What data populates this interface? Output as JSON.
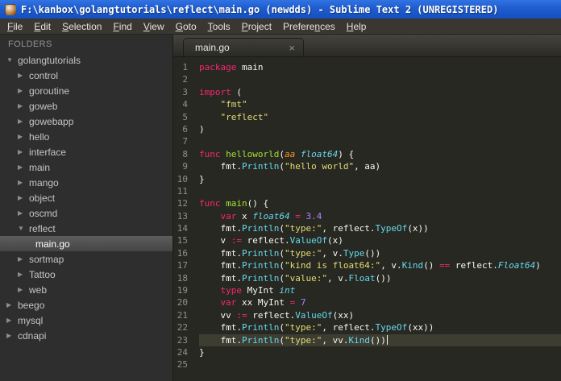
{
  "theme": {
    "bg-editor": "#272822",
    "line-hl": "#3E3D32",
    "kw": "#F92672",
    "fn": "#A6E22E",
    "ty": "#66D9EF",
    "st": "#E6DB74",
    "nu": "#AE81FF",
    "pa": "#FD971F",
    "pl": "#F8F8F2",
    "ln": "#8F908A"
  },
  "window": {
    "title": "F:\\kanbox\\golangtutorials\\reflect\\main.go (newdds) - Sublime Text 2 (UNREGISTERED)"
  },
  "menu": {
    "items": [
      {
        "label": "File",
        "mnemonic": 0
      },
      {
        "label": "Edit",
        "mnemonic": 0
      },
      {
        "label": "Selection",
        "mnemonic": 0
      },
      {
        "label": "Find",
        "mnemonic": 0
      },
      {
        "label": "View",
        "mnemonic": 0
      },
      {
        "label": "Goto",
        "mnemonic": 0
      },
      {
        "label": "Tools",
        "mnemonic": 0
      },
      {
        "label": "Project",
        "mnemonic": 0
      },
      {
        "label": "Preferences",
        "mnemonic": 7
      },
      {
        "label": "Help",
        "mnemonic": 0
      }
    ]
  },
  "sidebar": {
    "header": "FOLDERS",
    "tree": [
      {
        "label": "golangtutorials",
        "level": 0,
        "type": "folder",
        "expanded": true
      },
      {
        "label": "control",
        "level": 1,
        "type": "folder",
        "expanded": false
      },
      {
        "label": "goroutine",
        "level": 1,
        "type": "folder",
        "expanded": false
      },
      {
        "label": "goweb",
        "level": 1,
        "type": "folder",
        "expanded": false
      },
      {
        "label": "gowebapp",
        "level": 1,
        "type": "folder",
        "expanded": false
      },
      {
        "label": "hello",
        "level": 1,
        "type": "folder",
        "expanded": false
      },
      {
        "label": "interface",
        "level": 1,
        "type": "folder",
        "expanded": false
      },
      {
        "label": "main",
        "level": 1,
        "type": "folder",
        "expanded": false
      },
      {
        "label": "mango",
        "level": 1,
        "type": "folder",
        "expanded": false
      },
      {
        "label": "object",
        "level": 1,
        "type": "folder",
        "expanded": false
      },
      {
        "label": "oscmd",
        "level": 1,
        "type": "folder",
        "expanded": false
      },
      {
        "label": "reflect",
        "level": 1,
        "type": "folder",
        "expanded": true
      },
      {
        "label": "main.go",
        "level": 2,
        "type": "file",
        "selected": true
      },
      {
        "label": "sortmap",
        "level": 1,
        "type": "folder",
        "expanded": false
      },
      {
        "label": "Tattoo",
        "level": 1,
        "type": "folder",
        "expanded": false
      },
      {
        "label": "web",
        "level": 1,
        "type": "folder",
        "expanded": false
      },
      {
        "label": "beego",
        "level": 0,
        "type": "folder",
        "expanded": false
      },
      {
        "label": "mysql",
        "level": 0,
        "type": "folder",
        "expanded": false
      },
      {
        "label": "cdnapi",
        "level": 0,
        "type": "folder",
        "expanded": false
      }
    ]
  },
  "tabs": [
    {
      "label": "main.go",
      "close_glyph": "×",
      "active": true
    }
  ],
  "editor": {
    "lines": [
      {
        "num": 1,
        "tokens": [
          [
            "kw",
            "package"
          ],
          [
            "pl",
            " main"
          ]
        ]
      },
      {
        "num": 2,
        "tokens": []
      },
      {
        "num": 3,
        "tokens": [
          [
            "kw",
            "import"
          ],
          [
            "pl",
            " ("
          ]
        ]
      },
      {
        "num": 4,
        "tokens": [
          [
            "pl",
            "    "
          ],
          [
            "st",
            "\"fmt\""
          ]
        ]
      },
      {
        "num": 5,
        "tokens": [
          [
            "pl",
            "    "
          ],
          [
            "st",
            "\"reflect\""
          ]
        ]
      },
      {
        "num": 6,
        "tokens": [
          [
            "pl",
            ")"
          ]
        ]
      },
      {
        "num": 7,
        "tokens": []
      },
      {
        "num": 8,
        "tokens": [
          [
            "kw",
            "func"
          ],
          [
            "fn",
            " helloworld"
          ],
          [
            "pl",
            "("
          ],
          [
            "pa",
            "aa"
          ],
          [
            "pl",
            " "
          ],
          [
            "ty",
            "float64"
          ],
          [
            "pl",
            ") {"
          ]
        ]
      },
      {
        "num": 9,
        "tokens": [
          [
            "pl",
            "    fmt."
          ],
          [
            "su",
            "Println"
          ],
          [
            "pl",
            "("
          ],
          [
            "st",
            "\"hello world\""
          ],
          [
            "pl",
            ", aa)"
          ]
        ]
      },
      {
        "num": 10,
        "tokens": [
          [
            "pl",
            "}"
          ]
        ]
      },
      {
        "num": 11,
        "tokens": []
      },
      {
        "num": 12,
        "tokens": [
          [
            "kw",
            "func"
          ],
          [
            "fn",
            " main"
          ],
          [
            "pl",
            "() {"
          ]
        ]
      },
      {
        "num": 13,
        "tokens": [
          [
            "pl",
            "    "
          ],
          [
            "kw",
            "var"
          ],
          [
            "pl",
            " x "
          ],
          [
            "ty",
            "float64"
          ],
          [
            "pl",
            " "
          ],
          [
            "kw",
            "="
          ],
          [
            "pl",
            " "
          ],
          [
            "nu",
            "3.4"
          ]
        ]
      },
      {
        "num": 14,
        "tokens": [
          [
            "pl",
            "    fmt."
          ],
          [
            "su",
            "Println"
          ],
          [
            "pl",
            "("
          ],
          [
            "st",
            "\"type:\""
          ],
          [
            "pl",
            ", reflect."
          ],
          [
            "su",
            "TypeOf"
          ],
          [
            "pl",
            "(x))"
          ]
        ]
      },
      {
        "num": 15,
        "tokens": [
          [
            "pl",
            "    v "
          ],
          [
            "kw",
            ":="
          ],
          [
            "pl",
            " reflect."
          ],
          [
            "su",
            "ValueOf"
          ],
          [
            "pl",
            "(x)"
          ]
        ]
      },
      {
        "num": 16,
        "tokens": [
          [
            "pl",
            "    fmt."
          ],
          [
            "su",
            "Println"
          ],
          [
            "pl",
            "("
          ],
          [
            "st",
            "\"type:\""
          ],
          [
            "pl",
            ", v."
          ],
          [
            "su",
            "Type"
          ],
          [
            "pl",
            "())"
          ]
        ]
      },
      {
        "num": 17,
        "tokens": [
          [
            "pl",
            "    fmt."
          ],
          [
            "su",
            "Println"
          ],
          [
            "pl",
            "("
          ],
          [
            "st",
            "\"kind is float64:\""
          ],
          [
            "pl",
            ", v."
          ],
          [
            "su",
            "Kind"
          ],
          [
            "pl",
            "() "
          ],
          [
            "kw",
            "=="
          ],
          [
            "pl",
            " reflect."
          ],
          [
            "ty",
            "Float64"
          ],
          [
            "pl",
            ")"
          ]
        ]
      },
      {
        "num": 18,
        "tokens": [
          [
            "pl",
            "    fmt."
          ],
          [
            "su",
            "Println"
          ],
          [
            "pl",
            "("
          ],
          [
            "st",
            "\"value:\""
          ],
          [
            "pl",
            ", v."
          ],
          [
            "su",
            "Float"
          ],
          [
            "pl",
            "())"
          ]
        ]
      },
      {
        "num": 19,
        "tokens": [
          [
            "pl",
            "    "
          ],
          [
            "kw",
            "type"
          ],
          [
            "pl",
            " MyInt "
          ],
          [
            "ty",
            "int"
          ]
        ]
      },
      {
        "num": 20,
        "tokens": [
          [
            "pl",
            "    "
          ],
          [
            "kw",
            "var"
          ],
          [
            "pl",
            " xx MyInt "
          ],
          [
            "kw",
            "="
          ],
          [
            "pl",
            " "
          ],
          [
            "nu",
            "7"
          ]
        ]
      },
      {
        "num": 21,
        "tokens": [
          [
            "pl",
            "    vv "
          ],
          [
            "kw",
            ":="
          ],
          [
            "pl",
            " reflect."
          ],
          [
            "su",
            "ValueOf"
          ],
          [
            "pl",
            "(xx)"
          ]
        ]
      },
      {
        "num": 22,
        "tokens": [
          [
            "pl",
            "    fmt."
          ],
          [
            "su",
            "Println"
          ],
          [
            "pl",
            "("
          ],
          [
            "st",
            "\"type:\""
          ],
          [
            "pl",
            ", reflect."
          ],
          [
            "su",
            "TypeOf"
          ],
          [
            "pl",
            "(xx))"
          ]
        ]
      },
      {
        "num": 23,
        "tokens": [
          [
            "pl",
            "    fmt."
          ],
          [
            "su",
            "Println"
          ],
          [
            "pl",
            "("
          ],
          [
            "st",
            "\"type:\""
          ],
          [
            "pl",
            ", vv."
          ],
          [
            "su",
            "Kind"
          ],
          [
            "pl",
            "())"
          ]
        ],
        "current": true
      },
      {
        "num": 24,
        "tokens": [
          [
            "pl",
            "}"
          ]
        ]
      },
      {
        "num": 25,
        "tokens": []
      }
    ]
  }
}
